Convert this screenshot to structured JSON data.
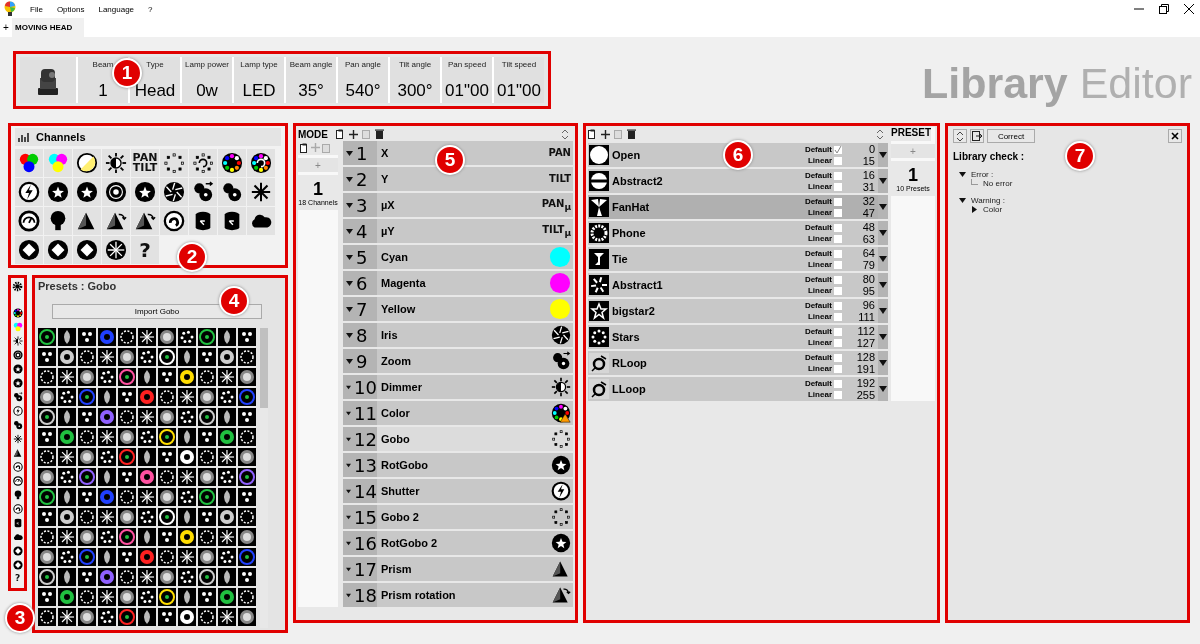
{
  "menu": [
    "File",
    "Options",
    "Language",
    "?"
  ],
  "document_tab": {
    "plus": "+",
    "label": "MOVING HEAD",
    "selected": true
  },
  "fixture_info": [
    {
      "label": "Beam",
      "value": "1"
    },
    {
      "label": "Type",
      "value": "Head"
    },
    {
      "label": "Lamp power",
      "value": "0w"
    },
    {
      "label": "Lamp type",
      "value": "LED"
    },
    {
      "label": "Beam angle",
      "value": "35°"
    },
    {
      "label": "Pan angle",
      "value": "540°"
    },
    {
      "label": "Tilt angle",
      "value": "300°"
    },
    {
      "label": "Pan speed",
      "value": "01\"00"
    },
    {
      "label": "Tilt speed",
      "value": "01\"00"
    }
  ],
  "app_title": {
    "bold": "Library",
    "light": "Editor"
  },
  "channels_panel": {
    "title": "Channels",
    "types": [
      {
        "kind": "rgb"
      },
      {
        "kind": "cmy"
      },
      {
        "kind": "cto"
      },
      {
        "kind": "sun"
      },
      {
        "kind": "text",
        "lines": [
          "PAN",
          "TILT"
        ]
      },
      {
        "kind": "dots-ring"
      },
      {
        "kind": "dots-ring-rot"
      },
      {
        "kind": "colorwheel"
      },
      {
        "kind": "colorwheel-rot"
      },
      {
        "kind": "lightning"
      },
      {
        "kind": "disc-star"
      },
      {
        "kind": "disc-star"
      },
      {
        "kind": "disc-rings"
      },
      {
        "kind": "disc-star"
      },
      {
        "kind": "iris"
      },
      {
        "kind": "zoom"
      },
      {
        "kind": "focus"
      },
      {
        "kind": "snowflake"
      },
      {
        "kind": "gauge"
      },
      {
        "kind": "bulb"
      },
      {
        "kind": "prism"
      },
      {
        "kind": "prism-rot"
      },
      {
        "kind": "prism-rot"
      },
      {
        "kind": "spiral"
      },
      {
        "kind": "cylinder"
      },
      {
        "kind": "cylinder"
      },
      {
        "kind": "cloud"
      },
      {
        "kind": "diamond"
      },
      {
        "kind": "diamond"
      },
      {
        "kind": "diamond"
      },
      {
        "kind": "burst"
      },
      {
        "kind": "text",
        "lines": [
          "?"
        ]
      }
    ]
  },
  "sidebar_icons": [
    {
      "kind": "colorwheel"
    },
    {
      "kind": "cmy"
    },
    {
      "kind": "sun"
    },
    {
      "kind": "disc-rings"
    },
    {
      "kind": "disc-star"
    },
    {
      "kind": "disc-star"
    },
    {
      "kind": "zoom"
    },
    {
      "kind": "lightning"
    },
    {
      "kind": "focus"
    },
    {
      "kind": "snowflake"
    },
    {
      "kind": "prism"
    },
    {
      "kind": "spiral"
    },
    {
      "kind": "gauge"
    },
    {
      "kind": "bulb"
    },
    {
      "kind": "spiral"
    },
    {
      "kind": "cylinder"
    },
    {
      "kind": "cloud"
    },
    {
      "kind": "diamond"
    },
    {
      "kind": "diamond"
    },
    {
      "kind": "text",
      "lines": [
        "?"
      ]
    }
  ],
  "presets_panel": {
    "title": "Presets : Gobo",
    "import_button": "Import Gobo"
  },
  "mode_panel": {
    "title": "MODE",
    "add": "+",
    "mode_number": "1",
    "mode_caption": "18 Channels",
    "channels": [
      {
        "number": "1",
        "name": "X",
        "icon": {
          "kind": "text",
          "lines": [
            "PAN"
          ]
        },
        "selected": false
      },
      {
        "number": "2",
        "name": "Y",
        "icon": {
          "kind": "text",
          "lines": [
            "TILT"
          ]
        },
        "selected": false
      },
      {
        "number": "3",
        "name": "µX",
        "icon": {
          "kind": "text",
          "lines": [
            "PAN"
          ],
          "sub": "µ"
        },
        "selected": false
      },
      {
        "number": "4",
        "name": "µY",
        "icon": {
          "kind": "text",
          "lines": [
            "TILT"
          ],
          "sub": "µ"
        },
        "selected": false
      },
      {
        "number": "5",
        "name": "Cyan",
        "icon": {
          "kind": "color"
        },
        "color": "#00ffff",
        "selected": false
      },
      {
        "number": "6",
        "name": "Magenta",
        "icon": {
          "kind": "color"
        },
        "color": "#ff00ff",
        "selected": false
      },
      {
        "number": "7",
        "name": "Yellow",
        "icon": {
          "kind": "color"
        },
        "color": "#ffff00",
        "selected": false
      },
      {
        "number": "8",
        "name": "Iris",
        "icon": {
          "kind": "iris"
        },
        "selected": false
      },
      {
        "number": "9",
        "name": "Zoom",
        "icon": {
          "kind": "zoom"
        },
        "selected": false
      },
      {
        "number": "10",
        "name": "Dimmer",
        "icon": {
          "kind": "sun"
        },
        "selected": false
      },
      {
        "number": "11",
        "name": "Color",
        "icon": {
          "kind": "colorwheel-warn"
        },
        "selected": false
      },
      {
        "number": "12",
        "name": "Gobo",
        "icon": {
          "kind": "dots-ring"
        },
        "selected": true
      },
      {
        "number": "13",
        "name": "RotGobo",
        "icon": {
          "kind": "disc-star"
        },
        "selected": false
      },
      {
        "number": "14",
        "name": "Shutter",
        "icon": {
          "kind": "lightning"
        },
        "selected": false
      },
      {
        "number": "15",
        "name": "Gobo 2",
        "icon": {
          "kind": "dots-ring"
        },
        "selected": false
      },
      {
        "number": "16",
        "name": "RotGobo 2",
        "icon": {
          "kind": "disc-star"
        },
        "selected": false
      },
      {
        "number": "17",
        "name": "Prism",
        "icon": {
          "kind": "prism"
        },
        "selected": false
      },
      {
        "number": "18",
        "name": "Prism rotation",
        "icon": {
          "kind": "prism-rot"
        },
        "selected": false
      }
    ]
  },
  "presets_list": {
    "items": [
      {
        "name": "Open",
        "kind": "open",
        "default_label": "Default",
        "default": true,
        "linear_label": "Linear",
        "linear": false,
        "from": "0",
        "to": "15",
        "selected": false
      },
      {
        "name": "Abstract2",
        "kind": "bar",
        "default_label": "Default",
        "default": false,
        "linear_label": "Linear",
        "linear": false,
        "from": "16",
        "to": "31",
        "selected": false
      },
      {
        "name": "FanHat",
        "kind": "fan",
        "default_label": "Default",
        "default": false,
        "linear_label": "Linear",
        "linear": false,
        "from": "32",
        "to": "47",
        "selected": true
      },
      {
        "name": "Phone",
        "kind": "ring",
        "default_label": "Default",
        "default": false,
        "linear_label": "Linear",
        "linear": false,
        "from": "48",
        "to": "63",
        "selected": false
      },
      {
        "name": "Tie",
        "kind": "tie",
        "default_label": "Default",
        "default": false,
        "linear_label": "Linear",
        "linear": false,
        "from": "64",
        "to": "79",
        "selected": false
      },
      {
        "name": "Abstract1",
        "kind": "burst",
        "default_label": "Default",
        "default": false,
        "linear_label": "Linear",
        "linear": false,
        "from": "80",
        "to": "95",
        "selected": false
      },
      {
        "name": "bigstar2",
        "kind": "star",
        "default_label": "Default",
        "default": false,
        "linear_label": "Linear",
        "linear": false,
        "from": "96",
        "to": "111",
        "selected": false
      },
      {
        "name": "Stars",
        "kind": "dots",
        "default_label": "Default",
        "default": false,
        "linear_label": "Linear",
        "linear": false,
        "from": "112",
        "to": "127",
        "selected": false
      },
      {
        "name": "RLoop",
        "kind": "loop",
        "default_label": "Default",
        "default": false,
        "linear_label": "Linear",
        "linear": false,
        "from": "128",
        "to": "191",
        "selected": false
      },
      {
        "name": "LLoop",
        "kind": "loop",
        "default_label": "Default",
        "default": false,
        "linear_label": "Linear",
        "linear": false,
        "from": "192",
        "to": "255",
        "selected": false
      }
    ]
  },
  "preset_column": {
    "title": "PRESET",
    "add": "+",
    "number": "1",
    "caption": "10 Presets"
  },
  "check_panel": {
    "correct_button": "Correct",
    "title": "Library check :",
    "tree": [
      {
        "label": "Error :",
        "expanded": true,
        "children": [
          {
            "label": "No error"
          }
        ]
      },
      {
        "label": "Warning :",
        "expanded": true,
        "children": [
          {
            "label": "Color",
            "expanded": false
          }
        ]
      }
    ]
  },
  "callouts": [
    "1",
    "2",
    "3",
    "4",
    "5",
    "6",
    "7"
  ]
}
